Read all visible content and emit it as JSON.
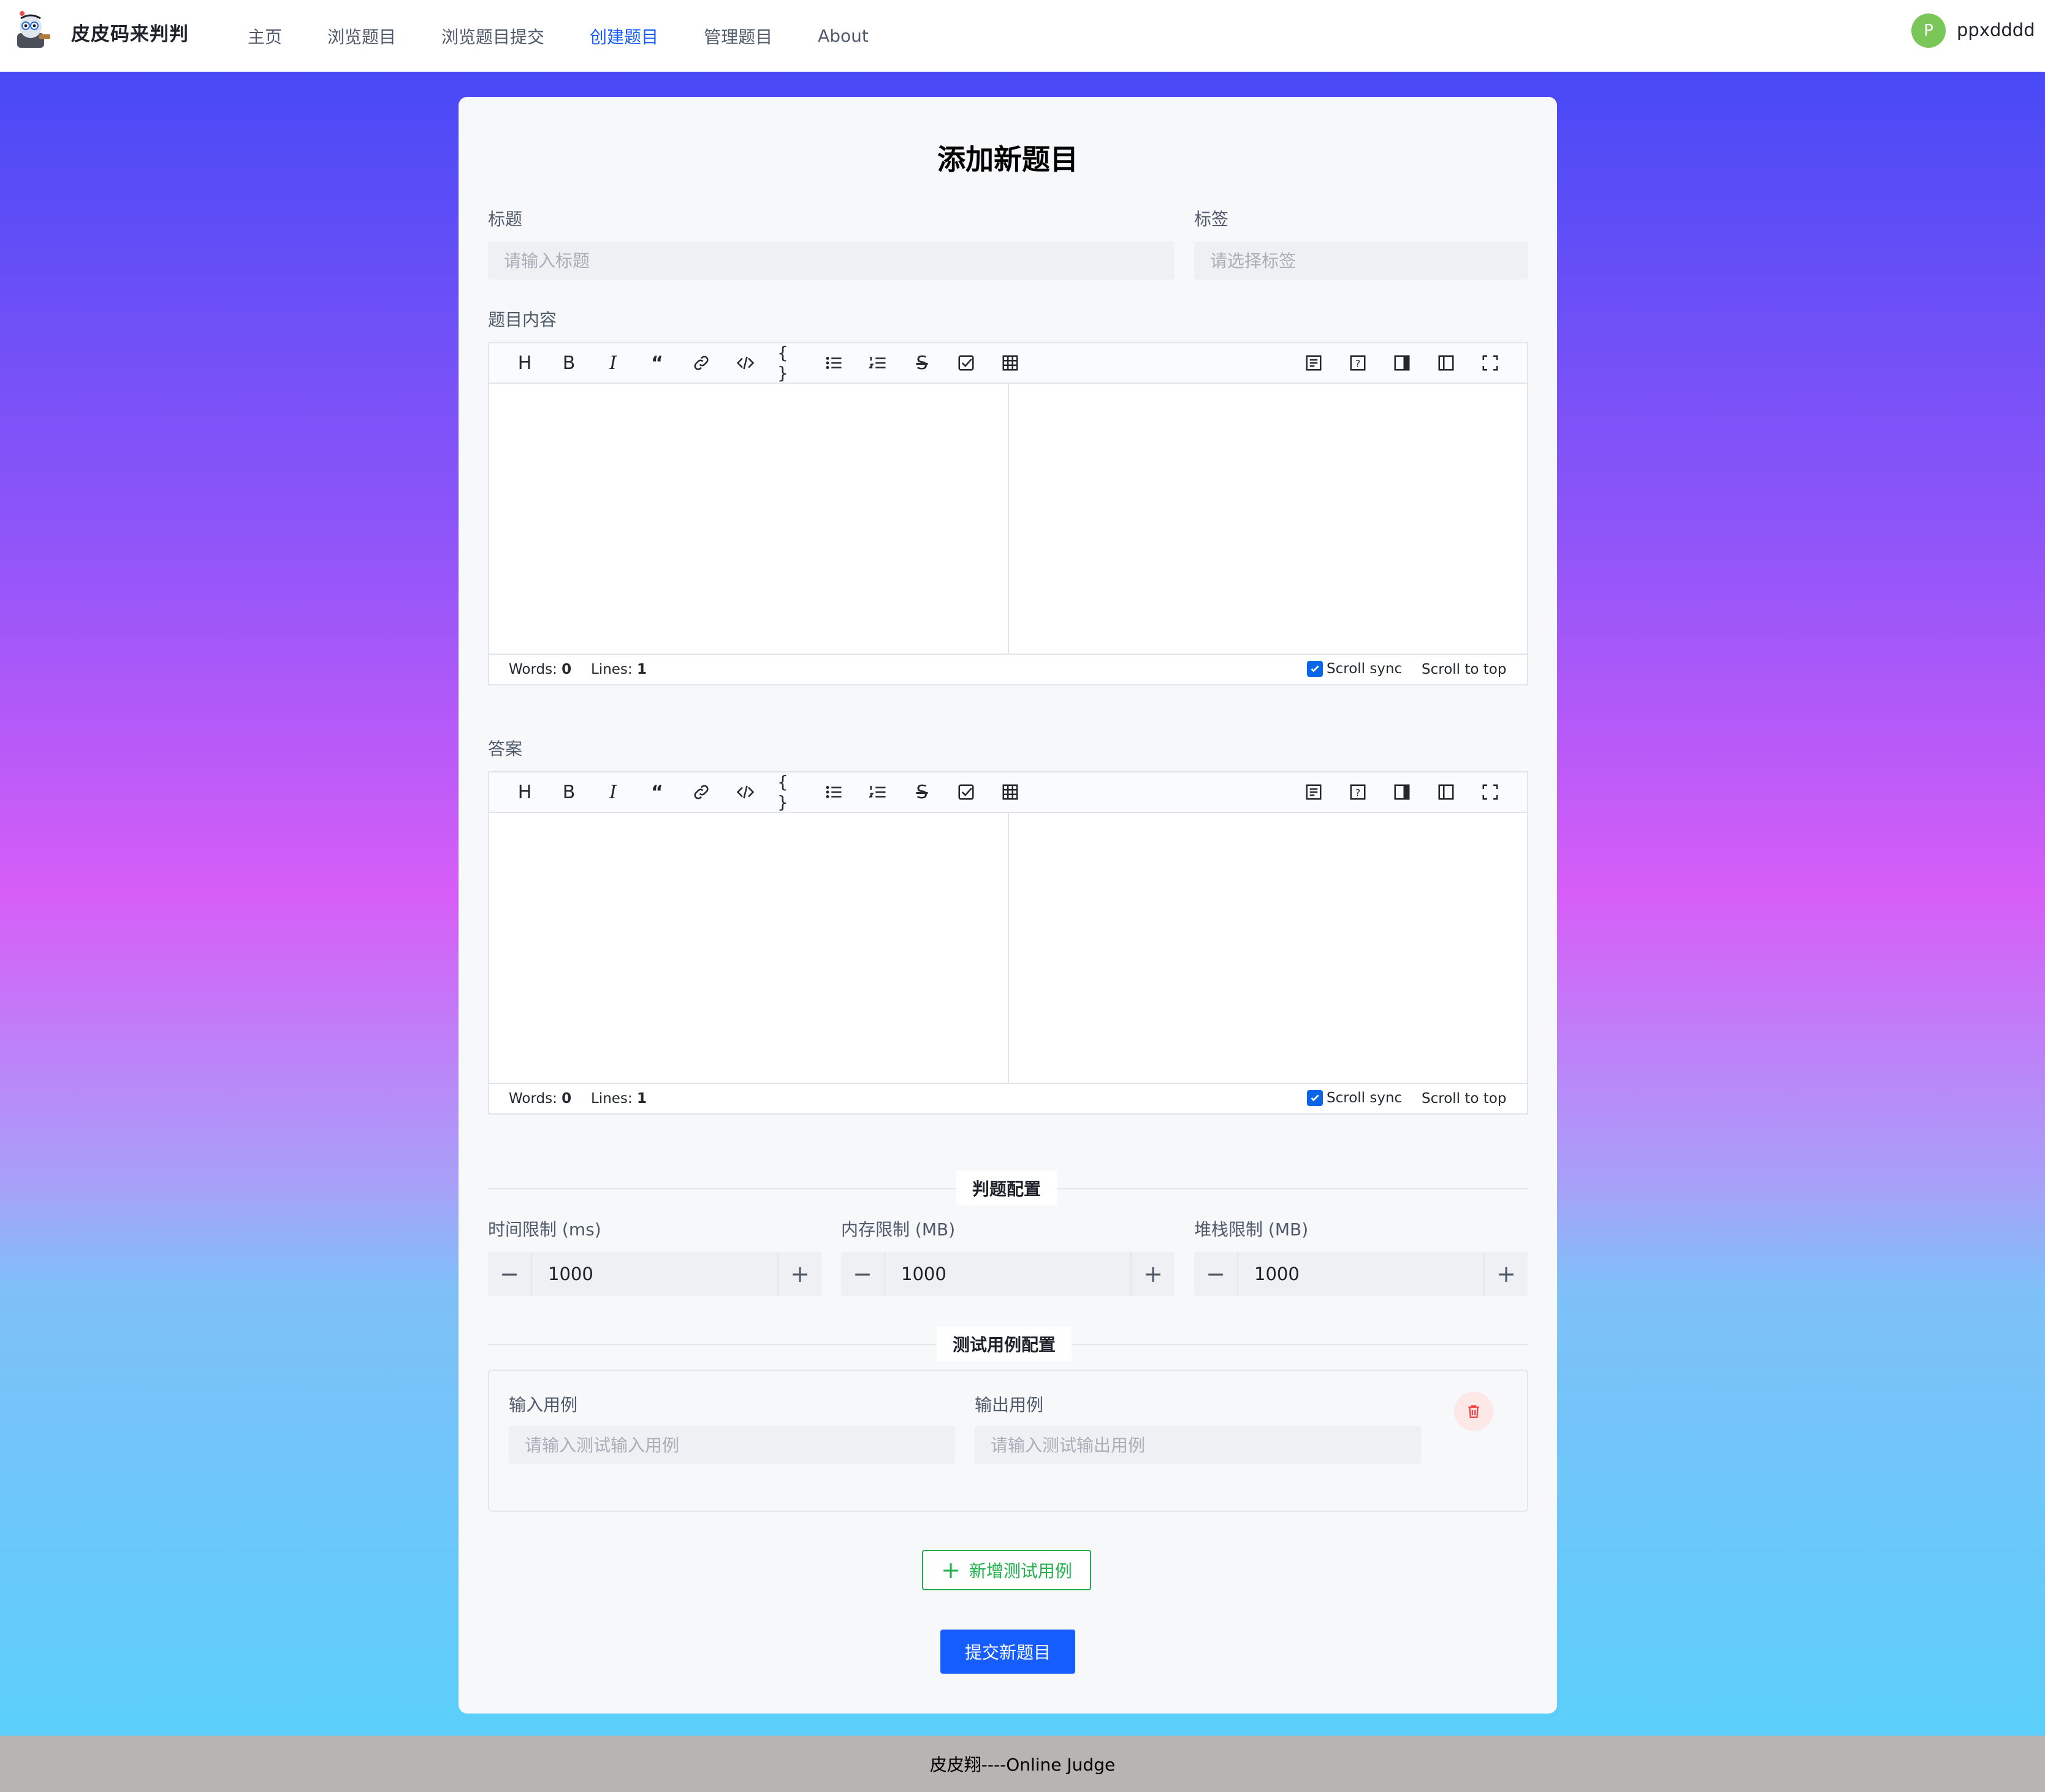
{
  "header": {
    "site_title": "皮皮码来判判",
    "nav": [
      "主页",
      "浏览题目",
      "浏览题目提交",
      "创建题目",
      "管理题目",
      "About"
    ],
    "active_nav": "创建题目",
    "user": {
      "initial": "P",
      "name": "ppxdddd"
    }
  },
  "form": {
    "title": "添加新题目",
    "title_label": "标题",
    "title_placeholder": "请输入标题",
    "tags_label": "标签",
    "tags_placeholder": "请选择标签",
    "content_label": "题目内容",
    "answer_label": "答案"
  },
  "editor": {
    "toolbar_left": [
      "heading-icon",
      "bold-icon",
      "italic-icon",
      "quote-icon",
      "link-icon",
      "code-icon",
      "code-block-icon",
      "unordered-list-icon",
      "ordered-list-icon",
      "strikethrough-icon",
      "task-list-icon",
      "table-icon"
    ],
    "toolbar_right": [
      "toc-icon",
      "help-icon",
      "preview-only-icon",
      "edit-only-icon",
      "fullscreen-icon"
    ],
    "words_label": "Words:",
    "words_value": "0",
    "lines_label": "Lines:",
    "lines_value": "1",
    "scroll_sync": "Scroll sync",
    "scroll_sync_checked": true,
    "scroll_top": "Scroll to top"
  },
  "judge_config": {
    "section_title": "判题配置",
    "time_label": "时间限制 (ms)",
    "time_value": "1000",
    "memory_label": "内存限制 (MB)",
    "memory_value": "1000",
    "stack_label": "堆栈限制 (MB)",
    "stack_value": "1000"
  },
  "test_cases": {
    "section_title": "测试用例配置",
    "input_label": "输入用例",
    "input_placeholder": "请输入测试输入用例",
    "output_label": "输出用例",
    "output_placeholder": "请输入测试输出用例",
    "add_button": "新增测试用例",
    "add_icon": "+"
  },
  "submit_button": "提交新题目",
  "footer": "皮皮翔----Online Judge",
  "colors": {
    "primary": "#165dff",
    "success": "#23b14d",
    "danger": "#f53f3f",
    "avatar": "#7bc658"
  }
}
